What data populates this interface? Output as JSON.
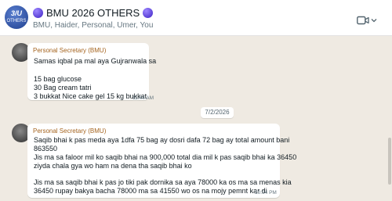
{
  "header": {
    "avatar_line1": "3/U",
    "avatar_line2": "OTHERS",
    "title": "BMU 2026 OTHERS",
    "subtitle": "BMU, Haider, Personal, Umer, You",
    "title_dot_color": "#5b3ff0"
  },
  "messages": [
    {
      "sender": "Personal Secretary (BMU)",
      "lines": [
        "Samas iqbal pa mal aya Gujranwala sa",
        "",
        "15 bag glucose",
        "30 Bag cream tatri",
        "3 bukkat Nice cake gel 15 kg bukkat"
      ],
      "time": "11:44 AM"
    },
    {
      "sender": "Personal Secretary (BMU)",
      "lines": [
        "Saqib bhai k pas meda aya 1dfa 75 bag ay dosri dafa 72 bag ay total amount bani",
        "863550",
        "Jis ma sa faloor mil ko saqib bhai na 900,000 total dia mil k pas saqib bhai ka 36450",
        "ziyda chala gya wo ham na dena tha saqib bhai ko",
        "",
        "Jis ma sa saqib bhai k pas jo tiki pak dornika sa aya 78000 ka os ma sa menas kia",
        "36450 rupay bakya bacha 78000 ma sa 41550 wo os na mojy pemnt kar di"
      ],
      "time": "10:04 PM"
    }
  ],
  "date_separator": "7/2/2026",
  "icons": {
    "video": "video-call-icon",
    "dropdown": "chevron-down-icon"
  }
}
